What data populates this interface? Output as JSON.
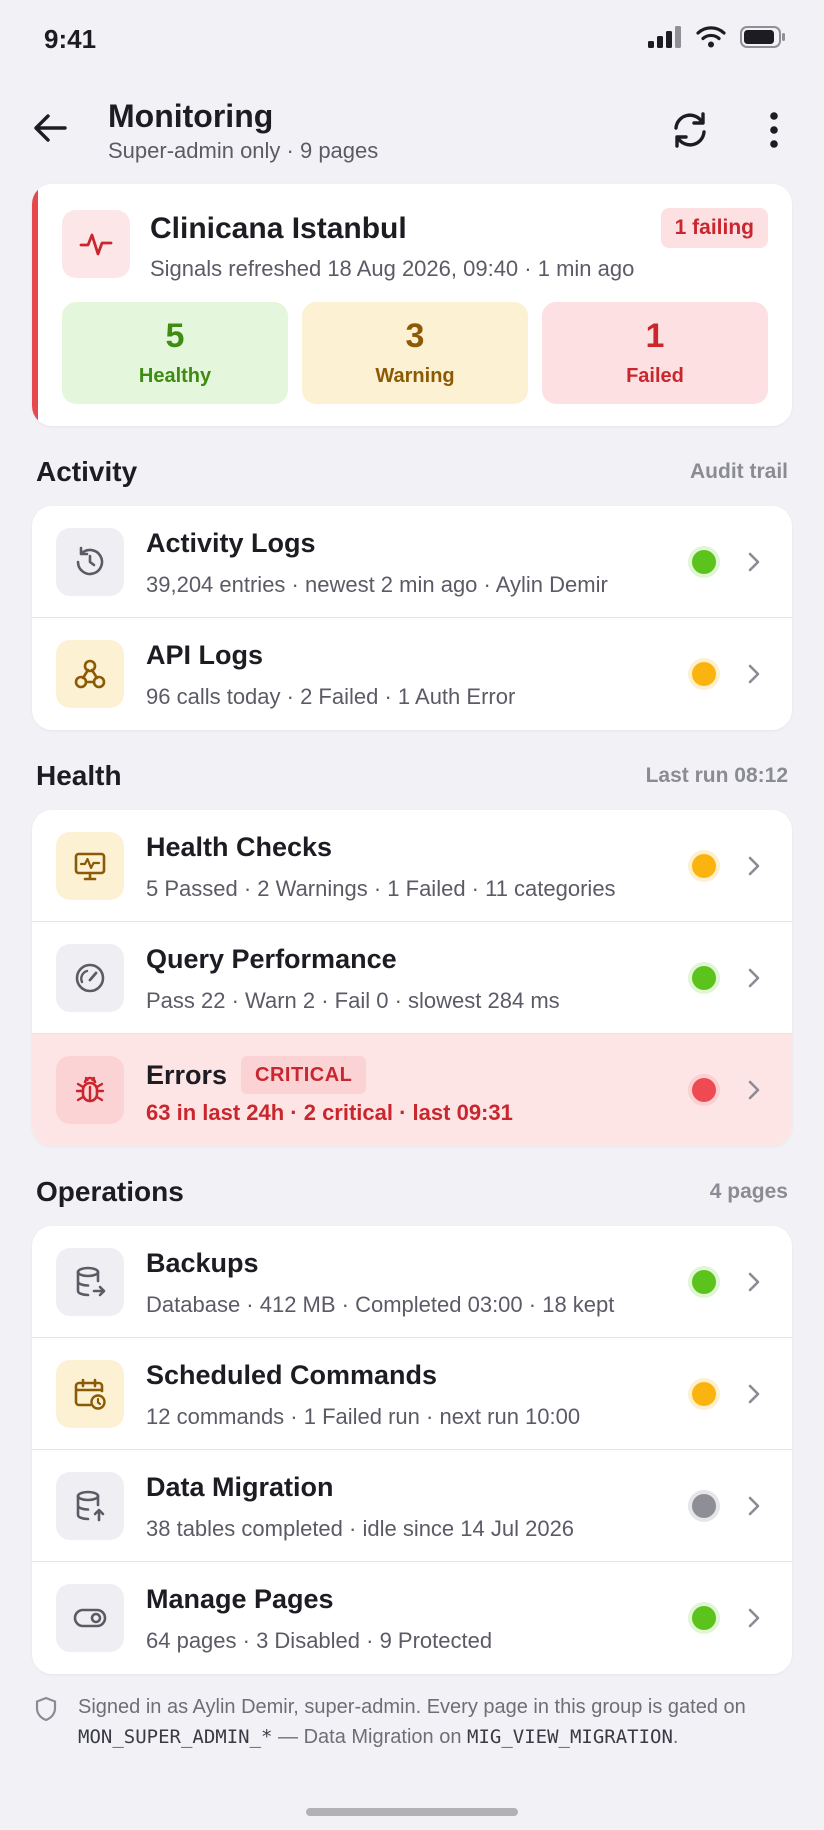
{
  "status_bar": {
    "time": "9:41"
  },
  "header": {
    "title": "Monitoring",
    "subtitle": "Super-admin only · 9 pages"
  },
  "summary": {
    "name": "Clinicana Istanbul",
    "meta": "Signals refreshed 18 Aug 2026, 09:40 · 1 min ago",
    "badge": "1 failing",
    "stats": [
      {
        "value": "5",
        "label": "Healthy"
      },
      {
        "value": "3",
        "label": "Warning"
      },
      {
        "value": "1",
        "label": "Failed"
      }
    ]
  },
  "sections": {
    "activity": {
      "title": "Activity",
      "meta": "Audit trail",
      "items": [
        {
          "title": "Activity Logs",
          "subtitle": "39,204 entries · newest 2 min ago · Aylin Demir",
          "status": "green"
        },
        {
          "title": "API Logs",
          "subtitle": "96 calls today · 2 Failed · 1 Auth Error",
          "status": "amber"
        }
      ]
    },
    "health": {
      "title": "Health",
      "meta": "Last run 08:12",
      "items": [
        {
          "title": "Health Checks",
          "subtitle": "5 Passed · 2 Warnings · 1 Failed · 11 categories",
          "status": "amber"
        },
        {
          "title": "Query Performance",
          "subtitle": "Pass 22 · Warn 2 · Fail 0 · slowest 284 ms",
          "status": "green"
        },
        {
          "title": "Errors",
          "badge": "CRITICAL",
          "subtitle": "63 in last 24h · 2 critical · last 09:31",
          "status": "red"
        }
      ]
    },
    "operations": {
      "title": "Operations",
      "meta": "4 pages",
      "items": [
        {
          "title": "Backups",
          "subtitle": "Database · 412 MB · Completed 03:00 · 18 kept",
          "status": "green"
        },
        {
          "title": "Scheduled Commands",
          "subtitle": "12 commands · 1 Failed run · next run 10:00",
          "status": "amber"
        },
        {
          "title": "Data Migration",
          "subtitle": "38 tables completed · idle since 14 Jul 2026",
          "status": "gray"
        },
        {
          "title": "Manage Pages",
          "subtitle": "64 pages · 3 Disabled · 9 Protected",
          "status": "green"
        }
      ]
    }
  },
  "footnote": {
    "text_1": "Signed in as Aylin Demir, super-admin. Every page in this group is gated on ",
    "code_1": "MON_SUPER_ADMIN_*",
    "text_2": " — Data Migration on ",
    "code_2": "MIG_VIEW_MIGRATION",
    "text_3": "."
  },
  "colors": {
    "failed": "#e5484d",
    "healthy": "#5cc21c",
    "warning": "#fbb40f",
    "neutral": "#8e8e96"
  }
}
